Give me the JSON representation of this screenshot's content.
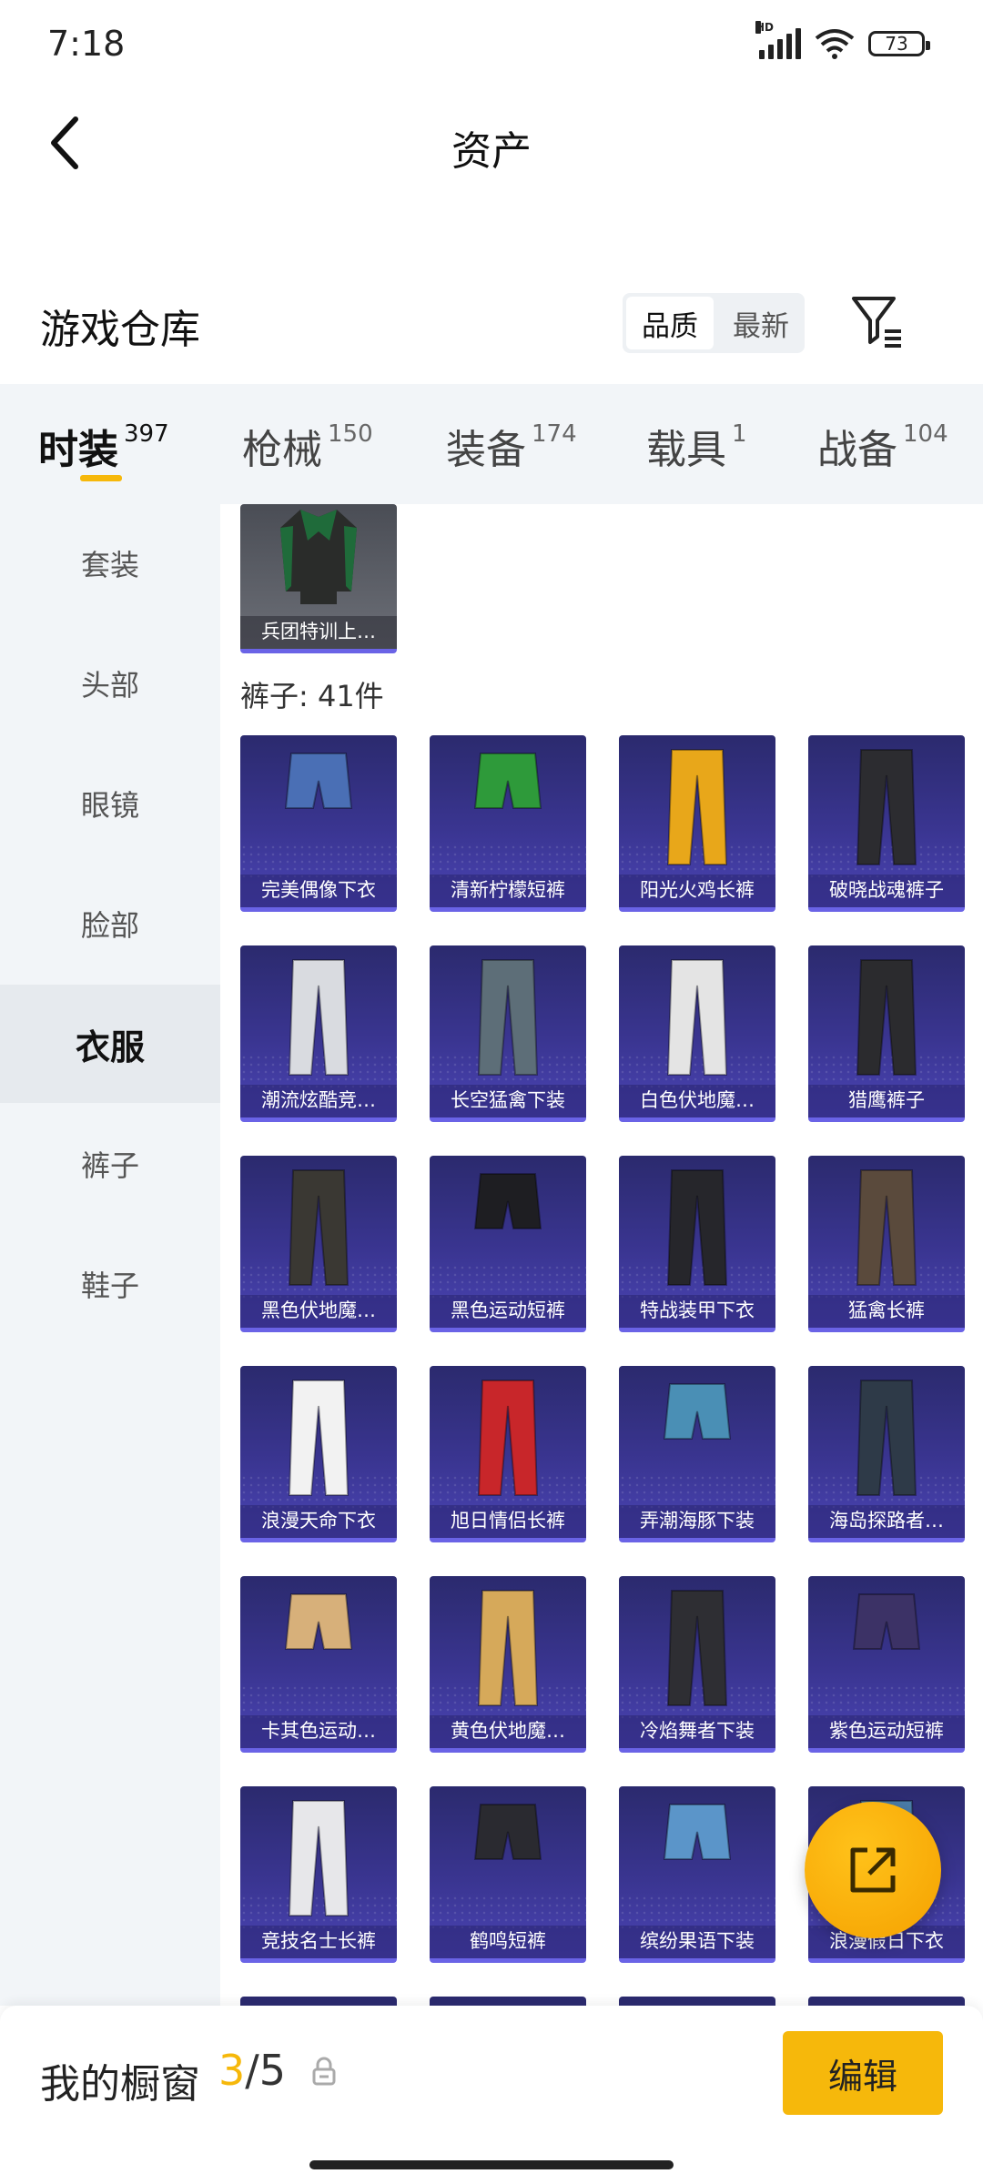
{
  "status_bar": {
    "time": "7:18",
    "battery": "73",
    "network": "HD"
  },
  "header": {
    "title": "资产"
  },
  "warehouse": {
    "title": "游戏仓库",
    "sort_options": [
      "品质",
      "最新"
    ],
    "sort_selected": "品质"
  },
  "category_tabs": [
    {
      "label": "时装",
      "count": "397",
      "active": true
    },
    {
      "label": "枪械",
      "count": "150"
    },
    {
      "label": "装备",
      "count": "174"
    },
    {
      "label": "载具",
      "count": "1"
    },
    {
      "label": "战备",
      "count": "104"
    }
  ],
  "sidebar": {
    "items": [
      "套装",
      "头部",
      "眼镜",
      "脸部",
      "衣服",
      "裤子",
      "鞋子"
    ],
    "selected": "衣服"
  },
  "content": {
    "top_item": {
      "name": "兵团特训上…"
    },
    "pants_section_label": "裤子: 41件",
    "pants": [
      {
        "name": "完美偶像下衣",
        "color": "#4a6fb5"
      },
      {
        "name": "清新柠檬短裤",
        "color": "#2e9a3a"
      },
      {
        "name": "阳光火鸡长裤",
        "color": "#e8a71a"
      },
      {
        "name": "破晓战魂裤子",
        "color": "#2c2c30"
      },
      {
        "name": "潮流炫酷竞…",
        "color": "#d9dbe0"
      },
      {
        "name": "长空猛禽下装",
        "color": "#5d6e78"
      },
      {
        "name": "白色伏地魔…",
        "color": "#e4e4e4"
      },
      {
        "name": "猎鹰裤子",
        "color": "#2b2b2e"
      },
      {
        "name": "黑色伏地魔…",
        "color": "#3a3833"
      },
      {
        "name": "黑色运动短裤",
        "color": "#1e1e22"
      },
      {
        "name": "特战装甲下衣",
        "color": "#26262b"
      },
      {
        "name": "猛禽长裤",
        "color": "#5a4a3c"
      },
      {
        "name": "浪漫天命下衣",
        "color": "#f2f2f2"
      },
      {
        "name": "旭日情侣长裤",
        "color": "#c8262a"
      },
      {
        "name": "弄潮海豚下装",
        "color": "#4a8fb5"
      },
      {
        "name": "海岛探路者…",
        "color": "#2e3a48"
      },
      {
        "name": "卡其色运动…",
        "color": "#d7b07a"
      },
      {
        "name": "黄色伏地魔…",
        "color": "#d6a95a"
      },
      {
        "name": "冷焰舞者下装",
        "color": "#2e2e33"
      },
      {
        "name": "紫色运动短裤",
        "color": "#3c3266"
      },
      {
        "name": "竞技名士长裤",
        "color": "#e7e7ea"
      },
      {
        "name": "鹤鸣短裤",
        "color": "#2a2a30"
      },
      {
        "name": "缤纷果语下装",
        "color": "#5b95c9"
      },
      {
        "name": "浪漫假日下衣",
        "color": "#4a7ca8"
      }
    ]
  },
  "bottom_bar": {
    "label": "我的橱窗",
    "current": "3",
    "separator": "/",
    "max": "5",
    "edit_label": "编辑"
  },
  "colors": {
    "accent": "#f6b80b",
    "card_bg": "#3a3591",
    "sidebar_bg": "#f2f5f8"
  }
}
